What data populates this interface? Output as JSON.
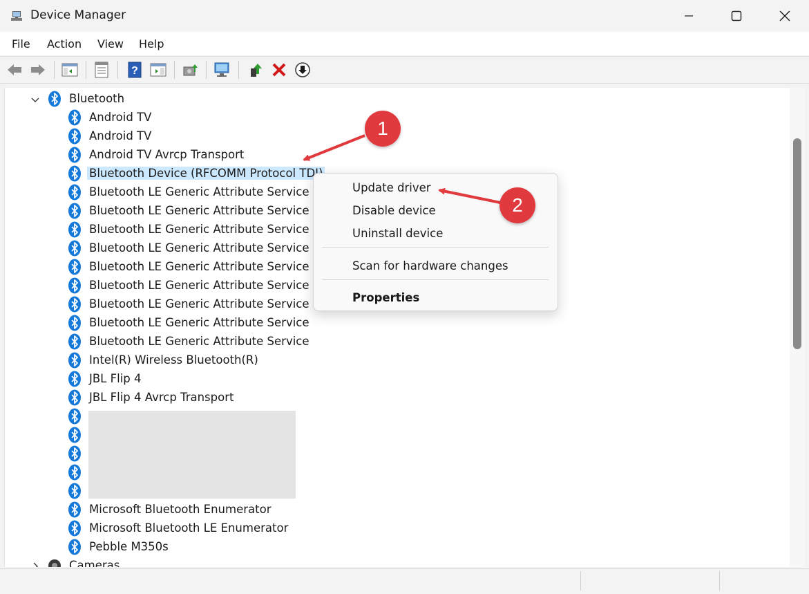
{
  "window": {
    "title": "Device Manager"
  },
  "menu": [
    "File",
    "Action",
    "View",
    "Help"
  ],
  "tree": {
    "category": "Bluetooth",
    "items": [
      "Android TV",
      "Android TV",
      "Android TV Avrcp Transport",
      "Bluetooth Device (RFCOMM Protocol TDI)",
      "Bluetooth LE Generic Attribute Service",
      "Bluetooth LE Generic Attribute Service",
      "Bluetooth LE Generic Attribute Service",
      "Bluetooth LE Generic Attribute Service",
      "Bluetooth LE Generic Attribute Service",
      "Bluetooth LE Generic Attribute Service",
      "Bluetooth LE Generic Attribute Service",
      "Bluetooth LE Generic Attribute Service",
      "Bluetooth LE Generic Attribute Service",
      "Intel(R) Wireless Bluetooth(R)",
      "JBL Flip 4",
      "JBL Flip 4 Avrcp Transport",
      "",
      "",
      "",
      "",
      "",
      "Microsoft Bluetooth Enumerator",
      "Microsoft Bluetooth LE Enumerator",
      "Pebble M350s"
    ],
    "next_category": "Cameras",
    "selected_item": "Bluetooth Device (RFCOMM Protocol TDI)"
  },
  "context_menu": {
    "update": "Update driver",
    "disable": "Disable device",
    "uninstall": "Uninstall device",
    "scan": "Scan for hardware changes",
    "properties": "Properties"
  },
  "annotations": {
    "step1": "1",
    "step2": "2"
  },
  "colors": {
    "annotation_red": "#e0393e",
    "selection": "#cce8ff",
    "bluetooth_blue": "#1479d9"
  }
}
